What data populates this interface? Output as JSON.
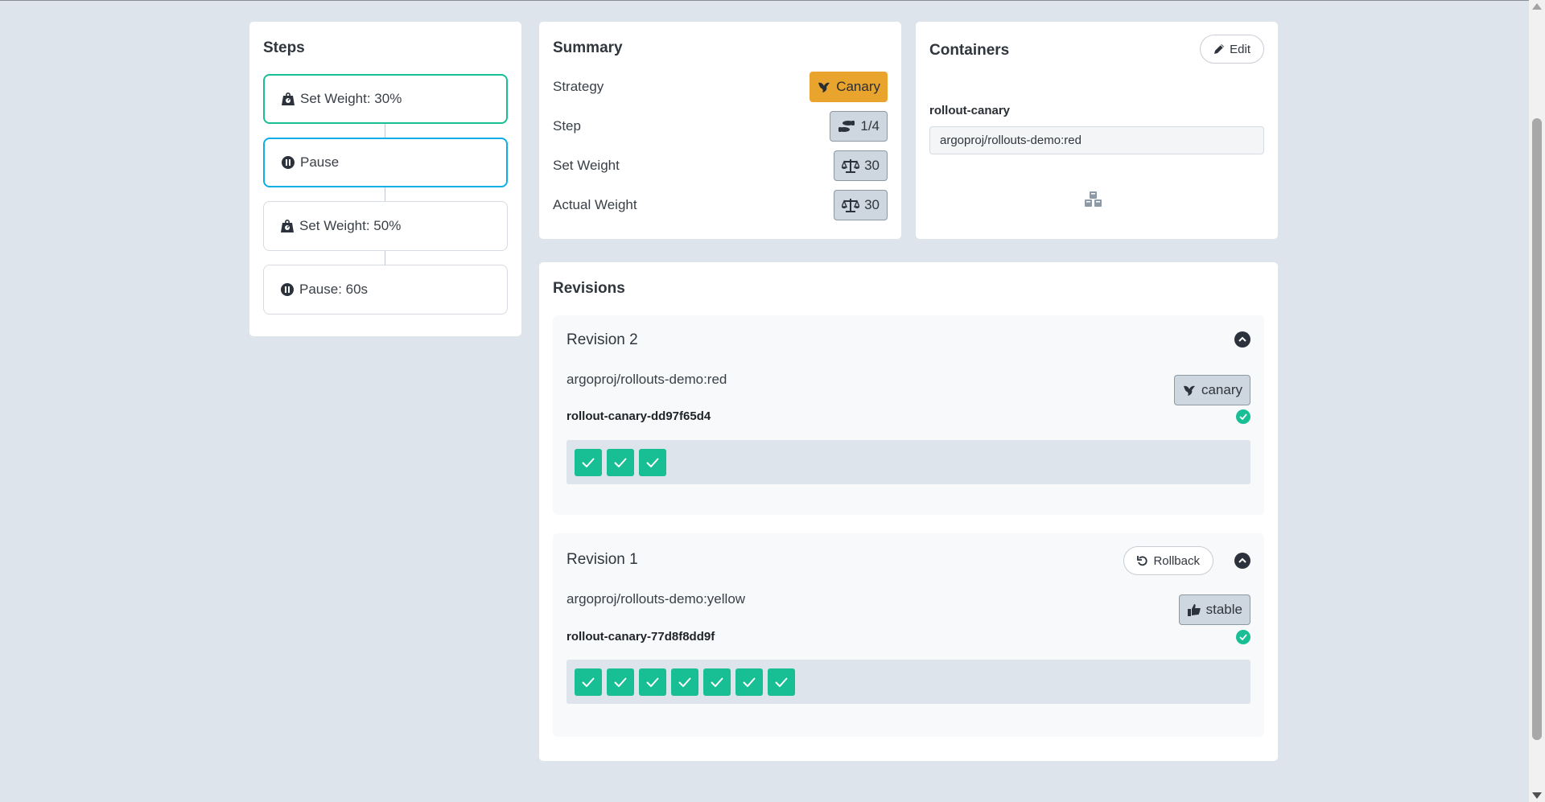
{
  "steps": {
    "title": "Steps",
    "items": [
      {
        "label": "Set Weight: 30%",
        "icon": "weight-icon",
        "state": "done"
      },
      {
        "label": "Pause",
        "icon": "pause-icon",
        "state": "current"
      },
      {
        "label": "Set Weight: 50%",
        "icon": "weight-icon",
        "state": "pending"
      },
      {
        "label": "Pause: 60s",
        "icon": "pause-icon",
        "state": "pending"
      }
    ]
  },
  "summary": {
    "title": "Summary",
    "rows": [
      {
        "label": "Strategy",
        "value": "Canary",
        "icon": "canary-bird-icon",
        "style": "gold"
      },
      {
        "label": "Step",
        "value": "1/4",
        "icon": "shoe-prints-icon",
        "style": "grey"
      },
      {
        "label": "Set Weight",
        "value": "30",
        "icon": "balance-scale-icon",
        "style": "grey"
      },
      {
        "label": "Actual Weight",
        "value": "30",
        "icon": "balance-scale-icon",
        "style": "grey"
      }
    ]
  },
  "containers": {
    "title": "Containers",
    "edit_label": "Edit",
    "name": "rollout-canary",
    "image": "argoproj/rollouts-demo:red"
  },
  "revisions": {
    "title": "Revisions",
    "items": [
      {
        "title": "Revision 2",
        "image": "argoproj/rollouts-demo:red",
        "badge": "canary",
        "badge_icon": "canary-bird-icon",
        "replicaset": "rollout-canary-dd97f65d4",
        "pods": 3,
        "rollback_label": null
      },
      {
        "title": "Revision 1",
        "image": "argoproj/rollouts-demo:yellow",
        "badge": "stable",
        "badge_icon": "thumbs-up-icon",
        "replicaset": "rollout-canary-77d8f8dd9f",
        "pods": 7,
        "rollback_label": "Rollback"
      }
    ]
  },
  "colors": {
    "background": "#dee4eb",
    "success": "#18be94",
    "current": "#0dadea",
    "canary_gold": "#e9a42d"
  }
}
